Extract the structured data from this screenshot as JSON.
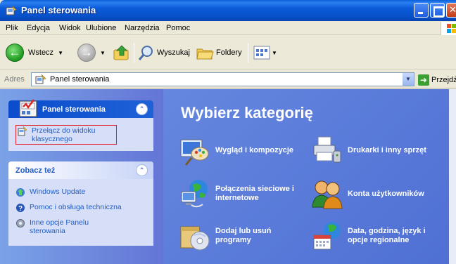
{
  "window": {
    "title": "Panel sterowania"
  },
  "menu": {
    "items": [
      {
        "label": "Plik"
      },
      {
        "label": "Edycja"
      },
      {
        "label": "Widok"
      },
      {
        "label": "Ulubione"
      },
      {
        "label": "Narzędzia"
      },
      {
        "label": "Pomoc"
      }
    ]
  },
  "toolbar": {
    "back_label": "Wstecz",
    "search_label": "Wyszukaj",
    "folders_label": "Foldery"
  },
  "address": {
    "label": "Adres",
    "value": "Panel sterowania",
    "go_label": "Przejdź"
  },
  "taskpane": {
    "control_panel": {
      "title": "Panel sterowania",
      "switch_link": "Przełącz do widoku klasycznego"
    },
    "see_also": {
      "title": "Zobacz też",
      "links": [
        {
          "label": "Windows Update"
        },
        {
          "label": "Pomoc i obsługa techniczna"
        },
        {
          "label": "Inne opcje Panelu sterowania"
        }
      ]
    }
  },
  "main": {
    "heading": "Wybierz kategorię",
    "categories": [
      {
        "label": "Wygląd i kompozycje",
        "icon": "appearance-icon"
      },
      {
        "label": "Drukarki i inny sprzęt",
        "icon": "printer-icon"
      },
      {
        "label": "Połączenia sieciowe i internetowe",
        "icon": "network-icon"
      },
      {
        "label": "Konta użytkowników",
        "icon": "users-icon"
      },
      {
        "label": "Dodaj lub usuń programy",
        "icon": "programs-icon"
      },
      {
        "label": "Data, godzina, język i opcje regionalne",
        "icon": "date-region-icon"
      }
    ]
  },
  "colors": {
    "title_bar": "#0b5bd8",
    "task_pane": "#6375d6",
    "main_pane": "#5a7edc",
    "link": "#215dc6",
    "highlight_box": "#e0202a"
  }
}
